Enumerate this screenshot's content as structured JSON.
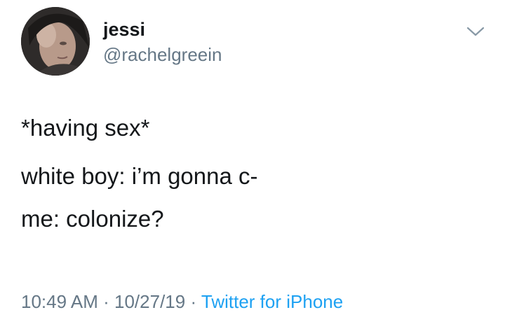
{
  "tweet": {
    "author": {
      "display_name": "jessi",
      "handle": "@rachelgreein",
      "avatar": "profile-photo"
    },
    "menu_icon": "chevron-down-icon",
    "text_lines": [
      "*having sex*",
      "white boy: i’m gonna c-",
      "me: colonize?"
    ],
    "meta": {
      "time": "10:49 AM",
      "date": "10/27/19",
      "separator": "·",
      "source": "Twitter for iPhone"
    }
  },
  "colors": {
    "text_primary": "#14171a",
    "text_secondary": "#657786",
    "link": "#1da1f2",
    "background": "#ffffff"
  }
}
